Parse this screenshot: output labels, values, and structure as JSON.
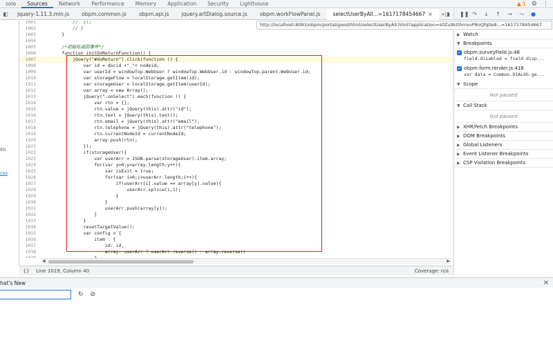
{
  "panel_tabs": [
    "sole",
    "Sources",
    "Network",
    "Performance",
    "Memory",
    "Application",
    "Security",
    "Lighthouse"
  ],
  "active_panel": "Sources",
  "warning_count": "1",
  "file_tabs": [
    "jquery-1.11.3.min.js",
    "obpm.common.js",
    "obpm.api.js",
    "jquery.artDialog.source.js",
    "obpm.workFlowPanel.js",
    "selectUserByAll...=1617178454667"
  ],
  "active_file": "selectUserByAll...=1617178454667",
  "url_tooltip": "http://localhost:8083/obpm/portal/good/html/selectUserByAll.html?application=s0Zu9ktthmxvP8oQfq0e8...=1617178454667",
  "navigator_fragments": [
    "ith",
    "ces"
  ],
  "code_lines": [
    {
      "n": "1001",
      "t": "            //  });"
    },
    {
      "n": "1002",
      "t": "            // }"
    },
    {
      "n": "1003",
      "t": "        }"
    },
    {
      "n": "1004",
      "t": ""
    },
    {
      "n": "1005",
      "t": "        /*初始化返回事件*/"
    },
    {
      "n": "1006",
      "t": "        function initOoReturnFunction() {"
    },
    {
      "n": "1007",
      "t": "            jQuery(\"#doReturn\").click(function () {"
    },
    {
      "n": "1008",
      "t": "                var id = docid +\"_\"+ nodeid;"
    },
    {
      "n": "1009",
      "t": "                var userId = windowTop.WebUser ? windowTop.WebUser.id : windowTop.parent.WebUser.id;"
    },
    {
      "n": "1010",
      "t": "                var storageFlow = localStorage.getItem(id);"
    },
    {
      "n": "1011",
      "t": "                var storageUser = localStorage.getItem(userId);"
    },
    {
      "n": "1012",
      "t": "                var array = new Array();"
    },
    {
      "n": "1013",
      "t": "                jQuery(\".onSelect\").each(function () {"
    },
    {
      "n": "1014",
      "t": "                    var rtn = {};"
    },
    {
      "n": "1015",
      "t": "                    rtn.value = jQuery(this).attr(\"id\");"
    },
    {
      "n": "1016",
      "t": "                    rtn.text = jQuery(this).text();"
    },
    {
      "n": "1017",
      "t": "                    rtn.email = jQuery(this).attr(\"email\");"
    },
    {
      "n": "1018",
      "t": "                    rtn.telephone = jQuery(this).attr(\"telephone\");"
    },
    {
      "n": "1019",
      "t": "                    rtn.currentNodeId = currentNodeId;"
    },
    {
      "n": "1020",
      "t": "                    array.push(rtn);"
    },
    {
      "n": "1021",
      "t": "                });"
    },
    {
      "n": "1022",
      "t": "                if(storageUser){"
    },
    {
      "n": "1023",
      "t": "                    var userArr = JSON.parse(storageUser).item.array;"
    },
    {
      "n": "1024",
      "t": "                    for(var y=0;y<array.length;y++){"
    },
    {
      "n": "1025",
      "t": "                        var isExit = true;"
    },
    {
      "n": "1026",
      "t": "                        for(var i=0;i<userArr.length;i++){"
    },
    {
      "n": "1027",
      "t": "                            if(userArr[i].value == array[y].value){"
    },
    {
      "n": "1028",
      "t": "                                userArr.splice(i,1);"
    },
    {
      "n": "1029",
      "t": "                            }"
    },
    {
      "n": "1030",
      "t": "                        }"
    },
    {
      "n": "1031",
      "t": "                        userArr.push(array[y]);"
    },
    {
      "n": "1032",
      "t": "                    }"
    },
    {
      "n": "1033",
      "t": "                }"
    },
    {
      "n": "1034",
      "t": "                resetTargetValue();"
    },
    {
      "n": "1035",
      "t": "                var config = {"
    },
    {
      "n": "1036",
      "t": "                    item : {"
    },
    {
      "n": "1037",
      "t": "                        id: id,"
    },
    {
      "n": "1038",
      "t": "                        array: userArr ? userArr.reverse() : array.reverse()"
    },
    {
      "n": "1039",
      "t": "                    }"
    },
    {
      "n": "1040",
      "t": "                }"
    }
  ],
  "highlight_line": "1007",
  "status": {
    "position": "Line 1019, Column 40",
    "coverage": "Coverage: n/a"
  },
  "sidebar": {
    "watch": "Watch",
    "breakpoints": "Breakpoints",
    "bp_items": [
      {
        "file": "obpm.surveyField.js:48",
        "code": "field.disabled = field.disp..."
      },
      {
        "file": "obpm.form.render.js:418",
        "code": "var data = Common.DIALOG.ge..."
      }
    ],
    "scope": "Scope",
    "scope_empty": "Not paused",
    "call_stack": "Call Stack",
    "call_stack_empty": "Not paused",
    "more_sections": [
      "XHR/fetch Breakpoints",
      "DOM Breakpoints",
      "Global Listeners",
      "Event Listener Breakpoints",
      "CSP Violation Breakpoints"
    ]
  },
  "drawer": {
    "title": "hat's New"
  },
  "colors": {
    "accent": "#1a73e8",
    "highlight": "#fffbdd",
    "red_box": "#e31a1a"
  }
}
